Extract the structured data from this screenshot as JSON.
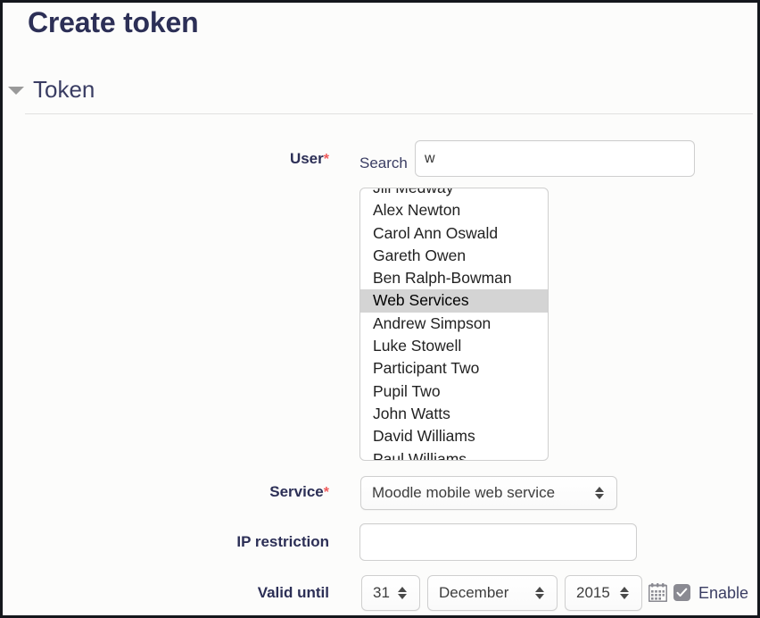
{
  "page": {
    "title": "Create token",
    "section_title": "Token",
    "accent_label_color": "#2c2f56",
    "required_star_color": "#f05a5a",
    "highlight_color": "#d4d4d4"
  },
  "form": {
    "user": {
      "label": "User",
      "required_marker": "*",
      "search_label": "Search",
      "search_value": "w",
      "search_placeholder": "",
      "options": [
        {
          "label": "Jill Medway",
          "selected": false
        },
        {
          "label": "Alex Newton",
          "selected": false
        },
        {
          "label": "Carol Ann Oswald",
          "selected": false
        },
        {
          "label": "Gareth Owen",
          "selected": false
        },
        {
          "label": "Ben Ralph-Bowman",
          "selected": false
        },
        {
          "label": "Web Services",
          "selected": true
        },
        {
          "label": "Andrew Simpson",
          "selected": false
        },
        {
          "label": "Luke Stowell",
          "selected": false
        },
        {
          "label": "Participant Two",
          "selected": false
        },
        {
          "label": "Pupil Two",
          "selected": false
        },
        {
          "label": "John Watts",
          "selected": false
        },
        {
          "label": "David Williams",
          "selected": false
        },
        {
          "label": "Paul Williams",
          "selected": false
        }
      ]
    },
    "service": {
      "label": "Service",
      "required_marker": "*",
      "value": "Moodle mobile web service"
    },
    "ip_restriction": {
      "label": "IP restriction",
      "value": "",
      "placeholder": ""
    },
    "valid_until": {
      "label": "Valid until",
      "day": "31",
      "month": "December",
      "year": "2015",
      "calendar_icon": "calendar-icon",
      "enable_label": "Enable",
      "enable_checked": true
    }
  }
}
